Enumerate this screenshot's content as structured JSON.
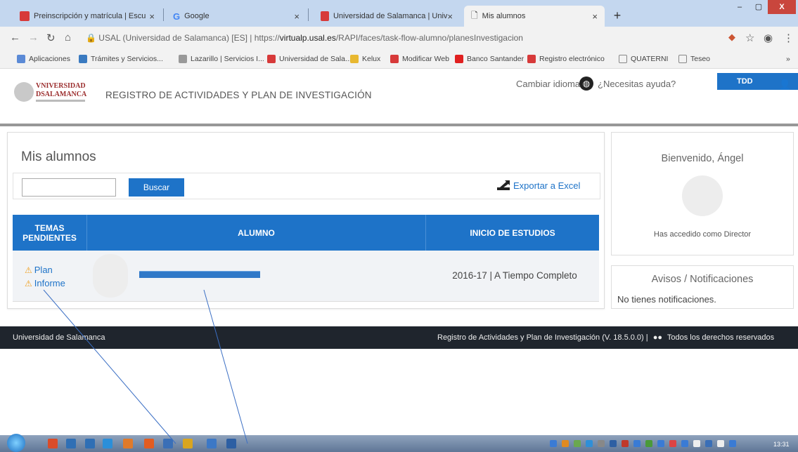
{
  "browser": {
    "tabs": [
      {
        "label": "Preinscripción y matrícula | Escu",
        "close": "×"
      },
      {
        "label": "Google",
        "close": "×"
      },
      {
        "label": "Universidad de Salamanca | Univ",
        "close": "×"
      },
      {
        "label": "Mis alumnos",
        "close": "×"
      }
    ],
    "new_tab": "+",
    "window_controls": [
      "–",
      "▢",
      "X"
    ],
    "address": {
      "site_label": "USAL (Universidad de Salamanca) [ES]",
      "url_prefix": "https://",
      "url_host": "virtualp.usal.es",
      "url_path": "/RAPI/faces/task-flow-alumno/planesInvestigacion"
    },
    "bookmarks": [
      "Aplicaciones",
      "Trámites y Servicios...",
      "Lazarillo | Servicios I...",
      "Universidad de Sala...",
      "Kelux",
      "Modificar Web",
      "Banco Santander",
      "Registro electrónico",
      "QUATERNI",
      "Teseo"
    ],
    "bookmarks_more": "»"
  },
  "header": {
    "logo_line1": "VNIVERSIDAD",
    "logo_line2": "DSALAMANCA",
    "app_title": "REGISTRO DE ACTIVIDADES Y PLAN DE INVESTIGACIÓN",
    "change_language": "Cambiar idioma",
    "help": "¿Necesitas ayuda?",
    "user": "TDD"
  },
  "main": {
    "title": "Mis alumnos",
    "search_button": "Buscar",
    "export": "Exportar a Excel",
    "columns": [
      "TEMAS PENDIENTES",
      "ALUMNO",
      "INICIO DE ESTUDIOS"
    ],
    "rows": [
      {
        "pending": [
          "Plan",
          "Informe"
        ],
        "student": "",
        "start": "2016-17 | A Tiempo Completo"
      }
    ]
  },
  "sidebar": {
    "welcome": "Bienvenido, Ángel",
    "role": "Has accedido como Director",
    "notices_title": "Avisos / Notificaciones",
    "notices_empty": "No tienes notificaciones."
  },
  "footer": {
    "left": "Universidad de Salamanca",
    "right_prefix": "Registro de Actividades y Plan de Investigación (V. 18.5.0.0) |",
    "right_suffix": "Todos los derechos reservados"
  },
  "taskbar": {
    "clock": "13:31"
  },
  "colors": {
    "accent": "#1e73c8",
    "footer": "#1f252d",
    "warning": "#f0a020"
  }
}
